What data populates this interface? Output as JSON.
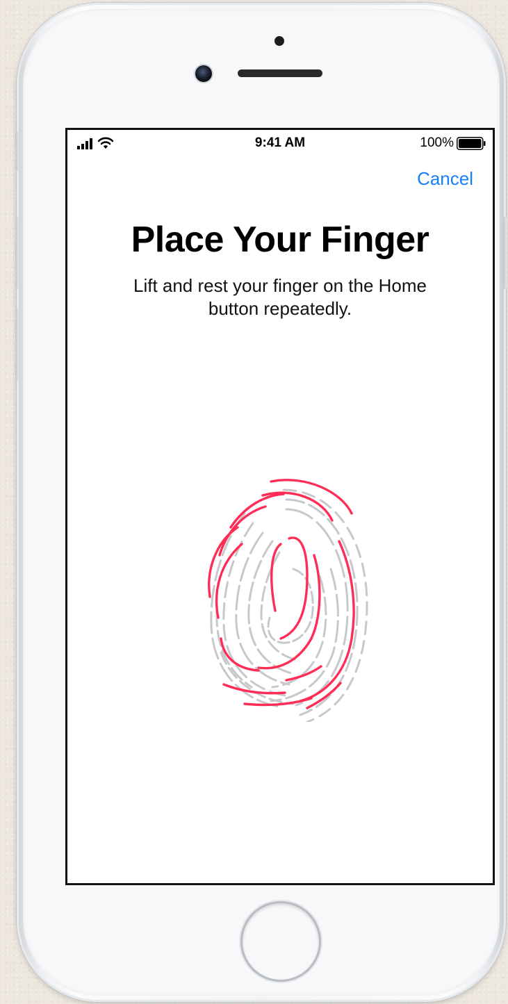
{
  "status_bar": {
    "time": "9:41 AM",
    "battery_percent": "100%",
    "battery_level": 1.0,
    "signal_icon": "cellular-signal-icon",
    "wifi_icon": "wifi-icon"
  },
  "nav": {
    "cancel_label": "Cancel"
  },
  "content": {
    "title": "Place Your Finger",
    "subtitle": "Lift and rest your finger on the Home button repeatedly."
  },
  "colors": {
    "accent_blue": "#157efb",
    "fingerprint_red": "#ff2d55",
    "fingerprint_gray": "#c7c7cc"
  },
  "icons": {
    "fingerprint": "touch-id-fingerprint-icon",
    "home_button": "home-button"
  }
}
